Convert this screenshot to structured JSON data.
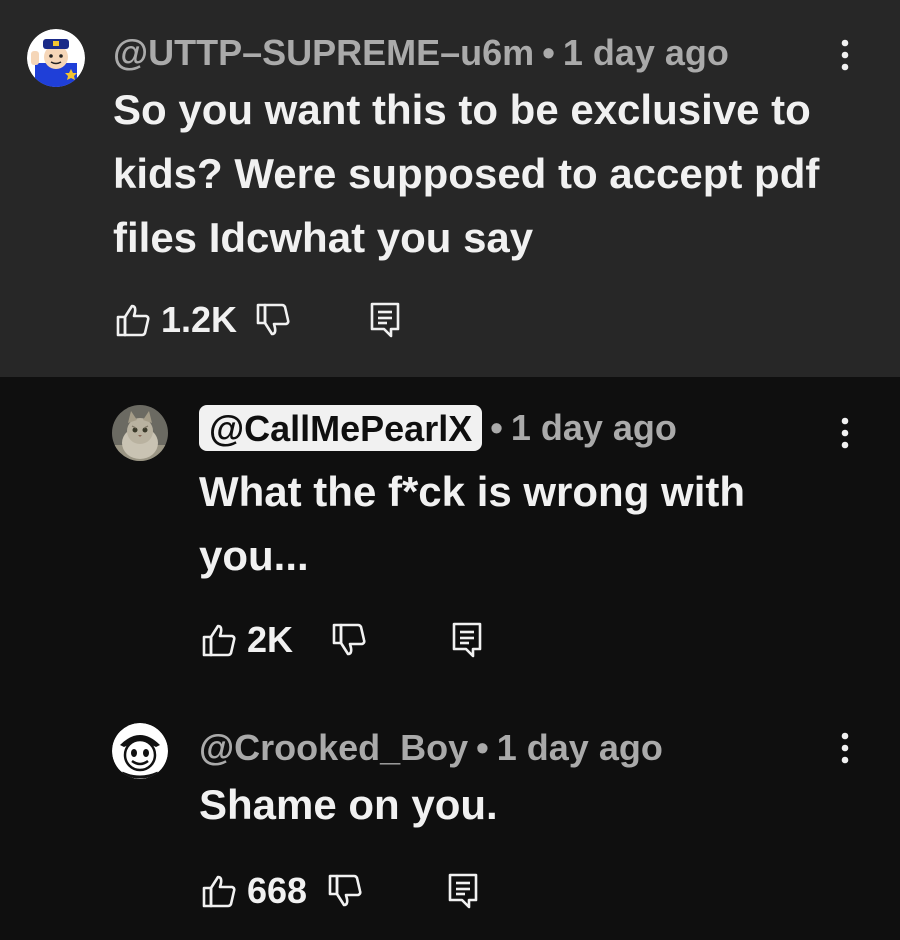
{
  "comments": [
    {
      "author": "@UTTP–SUPREME–u6m",
      "separator": "•",
      "time": "1 day ago",
      "text_lines": [
        "So you want this to be exclusive to",
        "kids? Were supposed to accept pdf",
        "files Idcwhat you say"
      ],
      "likes": "1.2K",
      "avatar_icon": "police-mascot-avatar",
      "menu_icon": "more-vertical-icon"
    },
    {
      "author": "@CallMePearlX",
      "separator": "•",
      "time": "1 day ago",
      "text_lines": [
        "What the f*ck is wrong with",
        "you..."
      ],
      "likes": "2K",
      "avatar_icon": "cat-avatar",
      "menu_icon": "more-vertical-icon"
    },
    {
      "author": "@Crooked_Boy",
      "separator": "•",
      "time": "1 day ago",
      "text_lines": [
        "Shame on you."
      ],
      "likes": "668",
      "avatar_icon": "cartoon-face-avatar",
      "menu_icon": "more-vertical-icon"
    }
  ],
  "colors": {
    "background": "#0f0f0f",
    "highlighted_comment_bg": "#272727",
    "primary_text": "#f1f1f1",
    "secondary_text": "#aaaaaa"
  }
}
